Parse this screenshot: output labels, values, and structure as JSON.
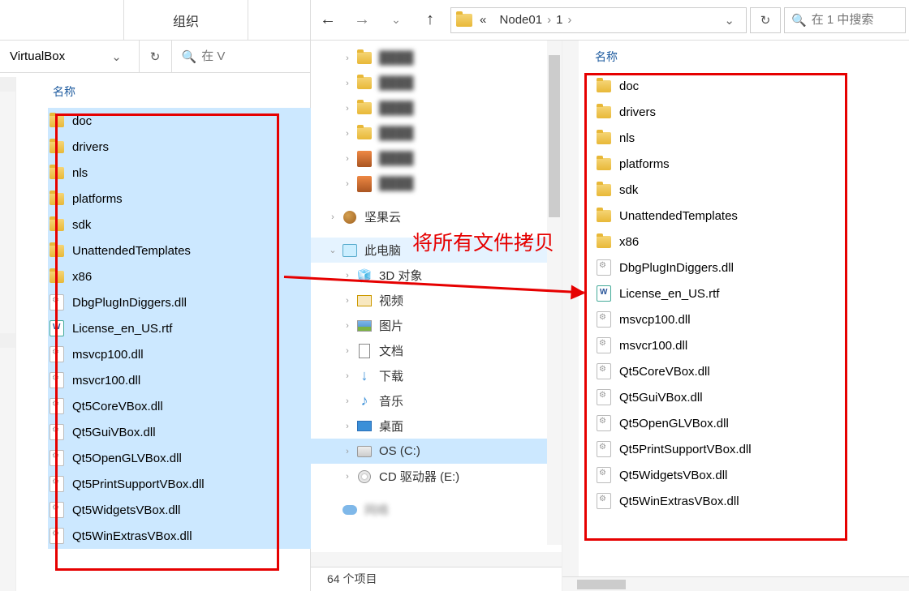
{
  "left": {
    "organize": "组织",
    "current_path": "VirtualBox",
    "search_placeholder": "在 V",
    "name_header": "名称",
    "files": [
      {
        "name": "doc",
        "type": "folder"
      },
      {
        "name": "drivers",
        "type": "folder"
      },
      {
        "name": "nls",
        "type": "folder"
      },
      {
        "name": "platforms",
        "type": "folder"
      },
      {
        "name": "sdk",
        "type": "folder"
      },
      {
        "name": "UnattendedTemplates",
        "type": "folder"
      },
      {
        "name": "x86",
        "type": "folder"
      },
      {
        "name": "DbgPlugInDiggers.dll",
        "type": "dll"
      },
      {
        "name": "License_en_US.rtf",
        "type": "rtf"
      },
      {
        "name": "msvcp100.dll",
        "type": "dll"
      },
      {
        "name": "msvcr100.dll",
        "type": "dll"
      },
      {
        "name": "Qt5CoreVBox.dll",
        "type": "dll"
      },
      {
        "name": "Qt5GuiVBox.dll",
        "type": "dll"
      },
      {
        "name": "Qt5OpenGLVBox.dll",
        "type": "dll"
      },
      {
        "name": "Qt5PrintSupportVBox.dll",
        "type": "dll"
      },
      {
        "name": "Qt5WidgetsVBox.dll",
        "type": "dll"
      },
      {
        "name": "Qt5WinExtrasVBox.dll",
        "type": "dll"
      }
    ]
  },
  "right": {
    "breadcrumb": [
      "«",
      "Node01",
      "1"
    ],
    "search_placeholder": "在 1 中搜索",
    "name_header": "名称",
    "tree": {
      "quick_folders": [
        {
          "label": "",
          "blur": true,
          "icon": "folder"
        },
        {
          "label": "",
          "blur": true,
          "icon": "folder"
        },
        {
          "label": "",
          "blur": true,
          "icon": "folder"
        },
        {
          "label": "",
          "blur": true,
          "icon": "folder"
        },
        {
          "label": "",
          "blur": true,
          "icon": "rar"
        },
        {
          "label": "",
          "blur": true,
          "icon": "rar"
        }
      ],
      "nutcloud": "坚果云",
      "this_pc": "此电脑",
      "pc_children": [
        {
          "label": "3D 对象",
          "icon": "3d"
        },
        {
          "label": "视频",
          "icon": "video"
        },
        {
          "label": "图片",
          "icon": "image"
        },
        {
          "label": "文档",
          "icon": "doc"
        },
        {
          "label": "下载",
          "icon": "download"
        },
        {
          "label": "音乐",
          "icon": "music"
        },
        {
          "label": "桌面",
          "icon": "desktop"
        },
        {
          "label": "OS (C:)",
          "icon": "drive",
          "selected": true
        },
        {
          "label": "CD 驱动器 (E:)",
          "icon": "disc"
        }
      ],
      "network": "网络"
    },
    "footer": "64 个项目",
    "files": [
      {
        "name": "doc",
        "type": "folder"
      },
      {
        "name": "drivers",
        "type": "folder"
      },
      {
        "name": "nls",
        "type": "folder"
      },
      {
        "name": "platforms",
        "type": "folder"
      },
      {
        "name": "sdk",
        "type": "folder"
      },
      {
        "name": "UnattendedTemplates",
        "type": "folder"
      },
      {
        "name": "x86",
        "type": "folder"
      },
      {
        "name": "DbgPlugInDiggers.dll",
        "type": "dll"
      },
      {
        "name": "License_en_US.rtf",
        "type": "rtf"
      },
      {
        "name": "msvcp100.dll",
        "type": "dll"
      },
      {
        "name": "msvcr100.dll",
        "type": "dll"
      },
      {
        "name": "Qt5CoreVBox.dll",
        "type": "dll"
      },
      {
        "name": "Qt5GuiVBox.dll",
        "type": "dll"
      },
      {
        "name": "Qt5OpenGLVBox.dll",
        "type": "dll"
      },
      {
        "name": "Qt5PrintSupportVBox.dll",
        "type": "dll"
      },
      {
        "name": "Qt5WidgetsVBox.dll",
        "type": "dll"
      },
      {
        "name": "Qt5WinExtrasVBox.dll",
        "type": "dll"
      }
    ]
  },
  "annotation": "将所有文件拷贝"
}
